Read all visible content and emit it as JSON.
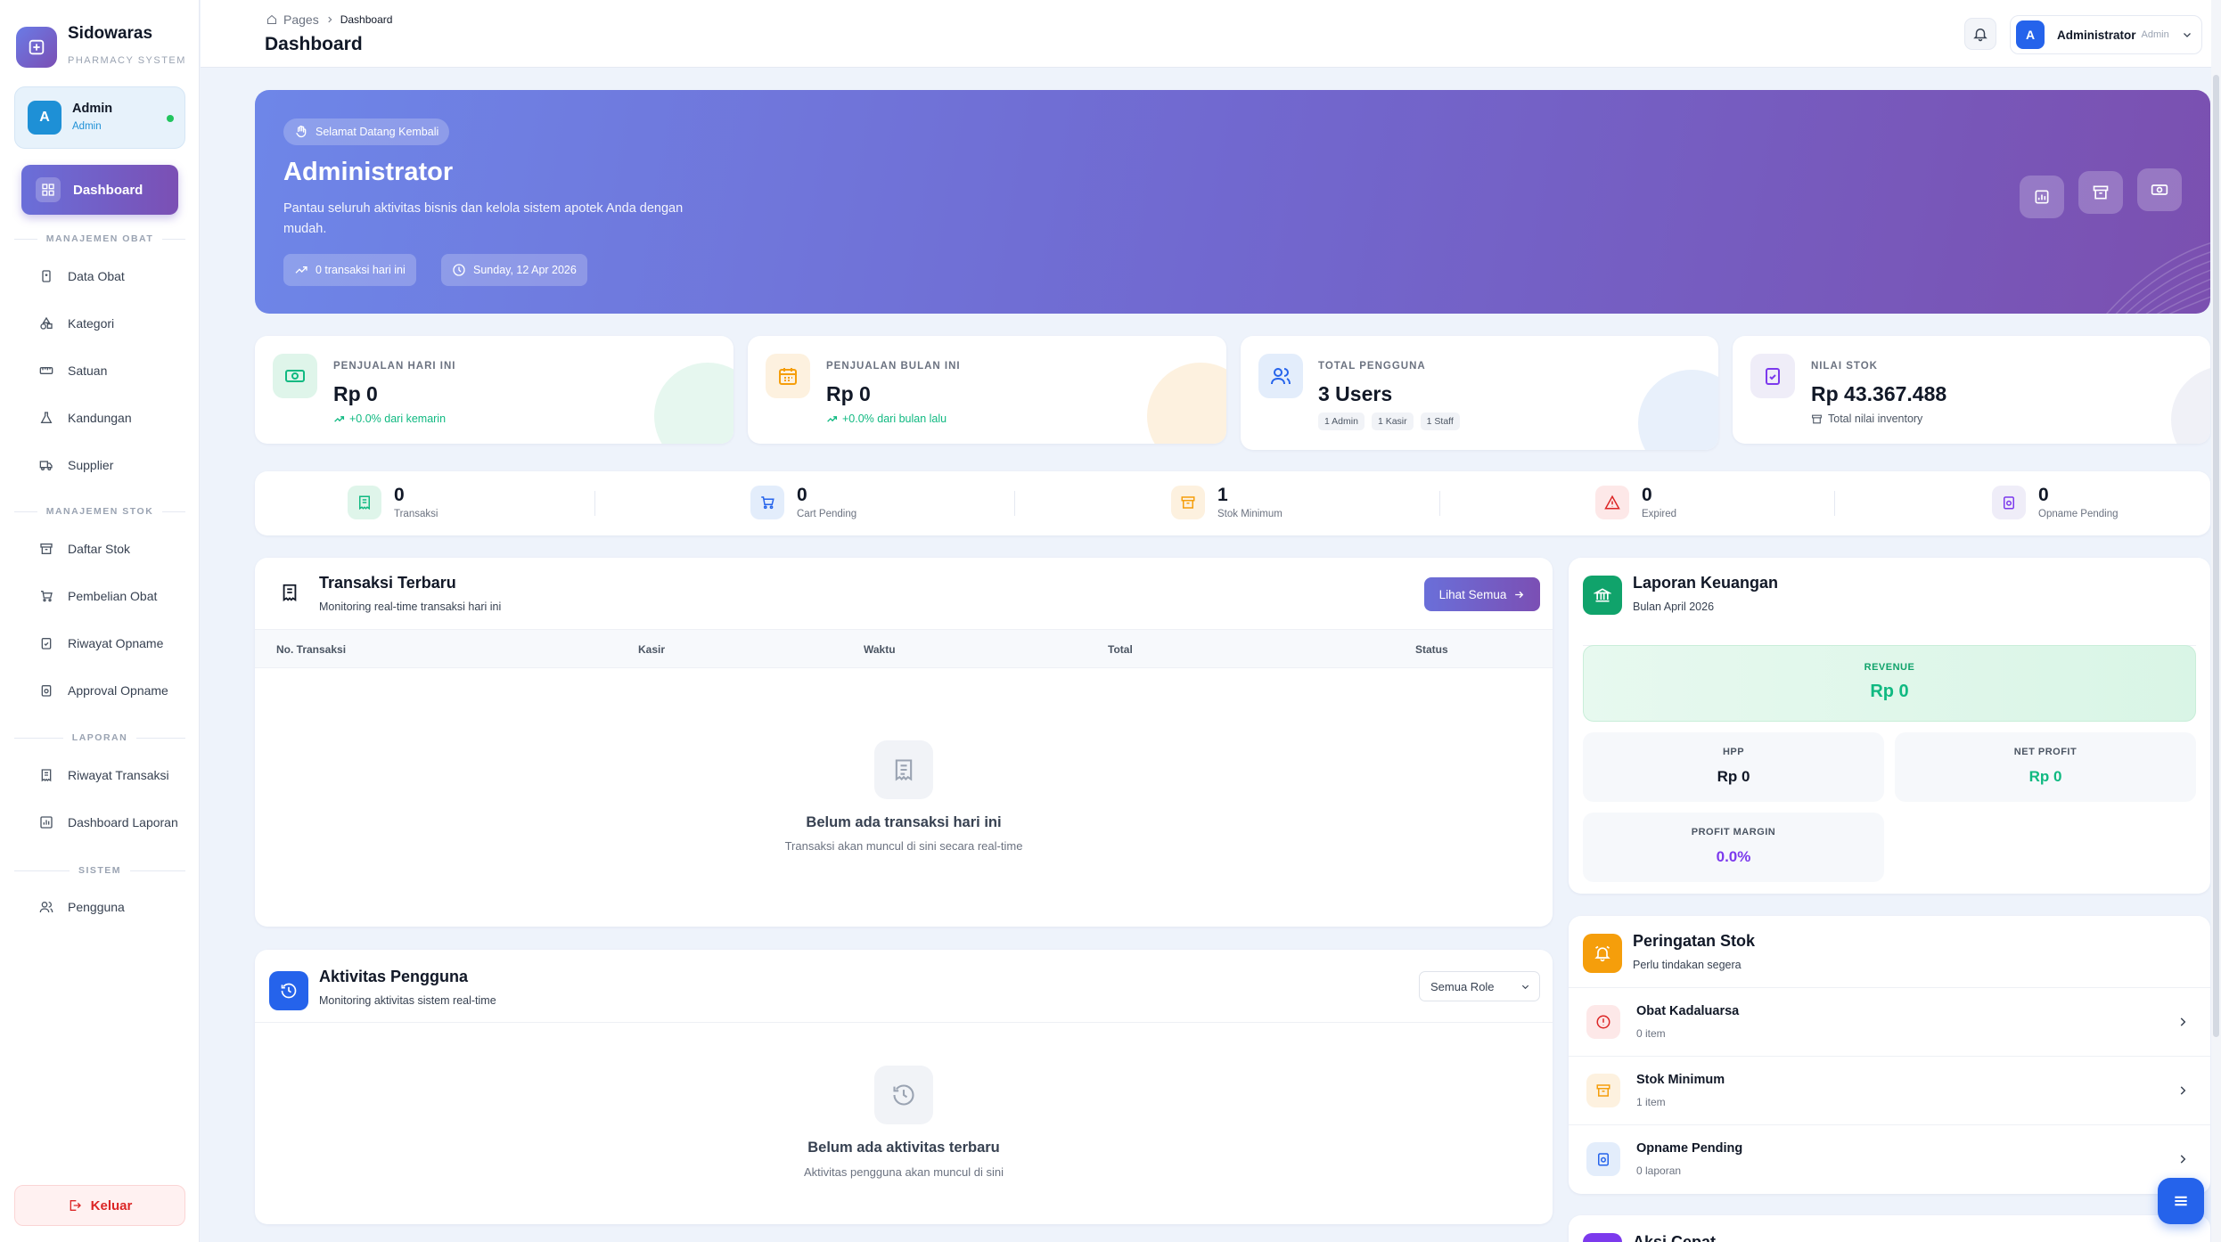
{
  "brand": {
    "name": "Sidowaras",
    "subtitle": "PHARMACY SYSTEM"
  },
  "sidebar": {
    "user": {
      "initial": "A",
      "name": "Admin",
      "role": "Admin"
    },
    "active": {
      "label": "Dashboard"
    },
    "sections": [
      {
        "title": "MANAJEMEN OBAT",
        "items": [
          "Data Obat",
          "Kategori",
          "Satuan",
          "Kandungan",
          "Supplier"
        ]
      },
      {
        "title": "MANAJEMEN STOK",
        "items": [
          "Daftar Stok",
          "Pembelian Obat",
          "Riwayat Opname",
          "Approval Opname"
        ]
      },
      {
        "title": "LAPORAN",
        "items": [
          "Riwayat Transaksi",
          "Dashboard Laporan"
        ]
      },
      {
        "title": "SISTEM",
        "items": [
          "Pengguna"
        ]
      }
    ],
    "logout": "Keluar"
  },
  "header": {
    "crumb_root": "Pages",
    "crumb_current": "Dashboard",
    "title": "Dashboard",
    "user_initial": "A",
    "user_name": "Administrator",
    "user_role": "Admin"
  },
  "hero": {
    "badge": "Selamat Datang Kembali",
    "title": "Administrator",
    "desc_line1": "Pantau seluruh aktivitas bisnis dan kelola sistem apotek Anda dengan",
    "desc_line2": "mudah.",
    "tx_pill": "0 transaksi hari ini",
    "date_pill": "Sunday, 12 Apr 2026"
  },
  "stats": [
    {
      "label": "PENJUALAN HARI INI",
      "value": "Rp 0",
      "note": "+0.0% dari kemarin"
    },
    {
      "label": "PENJUALAN BULAN INI",
      "value": "Rp 0",
      "note": "+0.0% dari bulan lalu"
    },
    {
      "label": "TOTAL PENGGUNA",
      "value": "3 Users",
      "tags": [
        "1 Admin",
        "1 Kasir",
        "1 Staff"
      ]
    },
    {
      "label": "NILAI STOK",
      "value": "Rp 43.367.488",
      "note": "Total nilai inventory"
    }
  ],
  "mini": [
    {
      "value": "0",
      "label": "Transaksi"
    },
    {
      "value": "0",
      "label": "Cart Pending"
    },
    {
      "value": "1",
      "label": "Stok Minimum"
    },
    {
      "value": "0",
      "label": "Expired"
    },
    {
      "value": "0",
      "label": "Opname Pending"
    }
  ],
  "transaksi": {
    "title": "Transaksi Terbaru",
    "subtitle": "Monitoring real-time transaksi hari ini",
    "button": "Lihat Semua",
    "columns": [
      "No. Transaksi",
      "Kasir",
      "Waktu",
      "Total",
      "Status"
    ],
    "empty_title": "Belum ada transaksi hari ini",
    "empty_sub": "Transaksi akan muncul di sini secara real-time"
  },
  "aktivitas": {
    "title": "Aktivitas Pengguna",
    "subtitle": "Monitoring aktivitas sistem real-time",
    "select": "Semua Role",
    "empty_title": "Belum ada aktivitas terbaru",
    "empty_sub": "Aktivitas pengguna akan muncul di sini"
  },
  "keuangan": {
    "title": "Laporan Keuangan",
    "subtitle": "Bulan April 2026",
    "revenue_label": "REVENUE",
    "revenue": "Rp 0",
    "hpp_label": "HPP",
    "hpp": "Rp 0",
    "net_label": "NET PROFIT",
    "net": "Rp 0",
    "margin_label": "PROFIT MARGIN",
    "margin": "0.0%"
  },
  "peringatan": {
    "title": "Peringatan Stok",
    "subtitle": "Perlu tindakan segera",
    "items": [
      {
        "title": "Obat Kadaluarsa",
        "sub": "0 item"
      },
      {
        "title": "Stok Minimum",
        "sub": "1 item"
      },
      {
        "title": "Opname Pending",
        "sub": "0 laporan"
      }
    ]
  },
  "aksi": {
    "title": "Aksi Cepat"
  },
  "colors": {
    "accent": "#7168cf",
    "green": "#10b981",
    "orange": "#f59e0b",
    "red": "#dc2626",
    "blue": "#2563eb"
  }
}
